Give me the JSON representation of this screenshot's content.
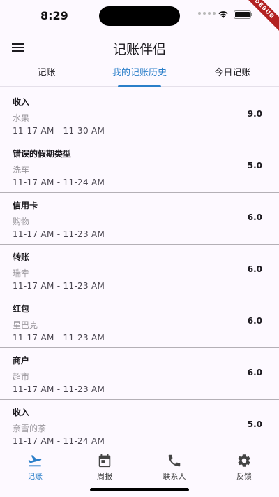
{
  "status_bar": {
    "time": "8:29"
  },
  "debug_banner": "DEBUG",
  "app_bar": {
    "title": "记账伴侣",
    "menu_icon": "menu-icon"
  },
  "tabs": [
    {
      "label": "记账",
      "active": false
    },
    {
      "label": "我的记账历史",
      "active": true
    },
    {
      "label": "今日记账",
      "active": false
    }
  ],
  "records": [
    {
      "type": "收入",
      "desc": "水果",
      "time_range": "11-17 AM - 11-30 AM",
      "amount": "9.0"
    },
    {
      "type": "错误的假期类型",
      "desc": "洗车",
      "time_range": "11-17 AM - 11-24 AM",
      "amount": "5.0"
    },
    {
      "type": "信用卡",
      "desc": "购物",
      "time_range": "11-17 AM - 11-23 AM",
      "amount": "6.0"
    },
    {
      "type": "转账",
      "desc": "瑞幸",
      "time_range": "11-17 AM - 11-23 AM",
      "amount": "6.0"
    },
    {
      "type": "红包",
      "desc": "星巴克",
      "time_range": "11-17 AM - 11-23 AM",
      "amount": "6.0"
    },
    {
      "type": "商户",
      "desc": "超市",
      "time_range": "11-17 AM - 11-23 AM",
      "amount": "6.0"
    },
    {
      "type": "收入",
      "desc": "奈雪的茶",
      "time_range": "11-17 AM - 11-24 AM",
      "amount": "5.0"
    }
  ],
  "bottom_nav": [
    {
      "label": "记账",
      "icon": "airplane-icon",
      "active": true
    },
    {
      "label": "周报",
      "icon": "calendar-icon",
      "active": false
    },
    {
      "label": "联系人",
      "icon": "phone-icon",
      "active": false
    },
    {
      "label": "反馈",
      "icon": "gear-icon",
      "active": false
    }
  ],
  "colors": {
    "accent": "#2b7fc9",
    "background": "#fdf9ff",
    "divider": "#b4b0b6"
  }
}
